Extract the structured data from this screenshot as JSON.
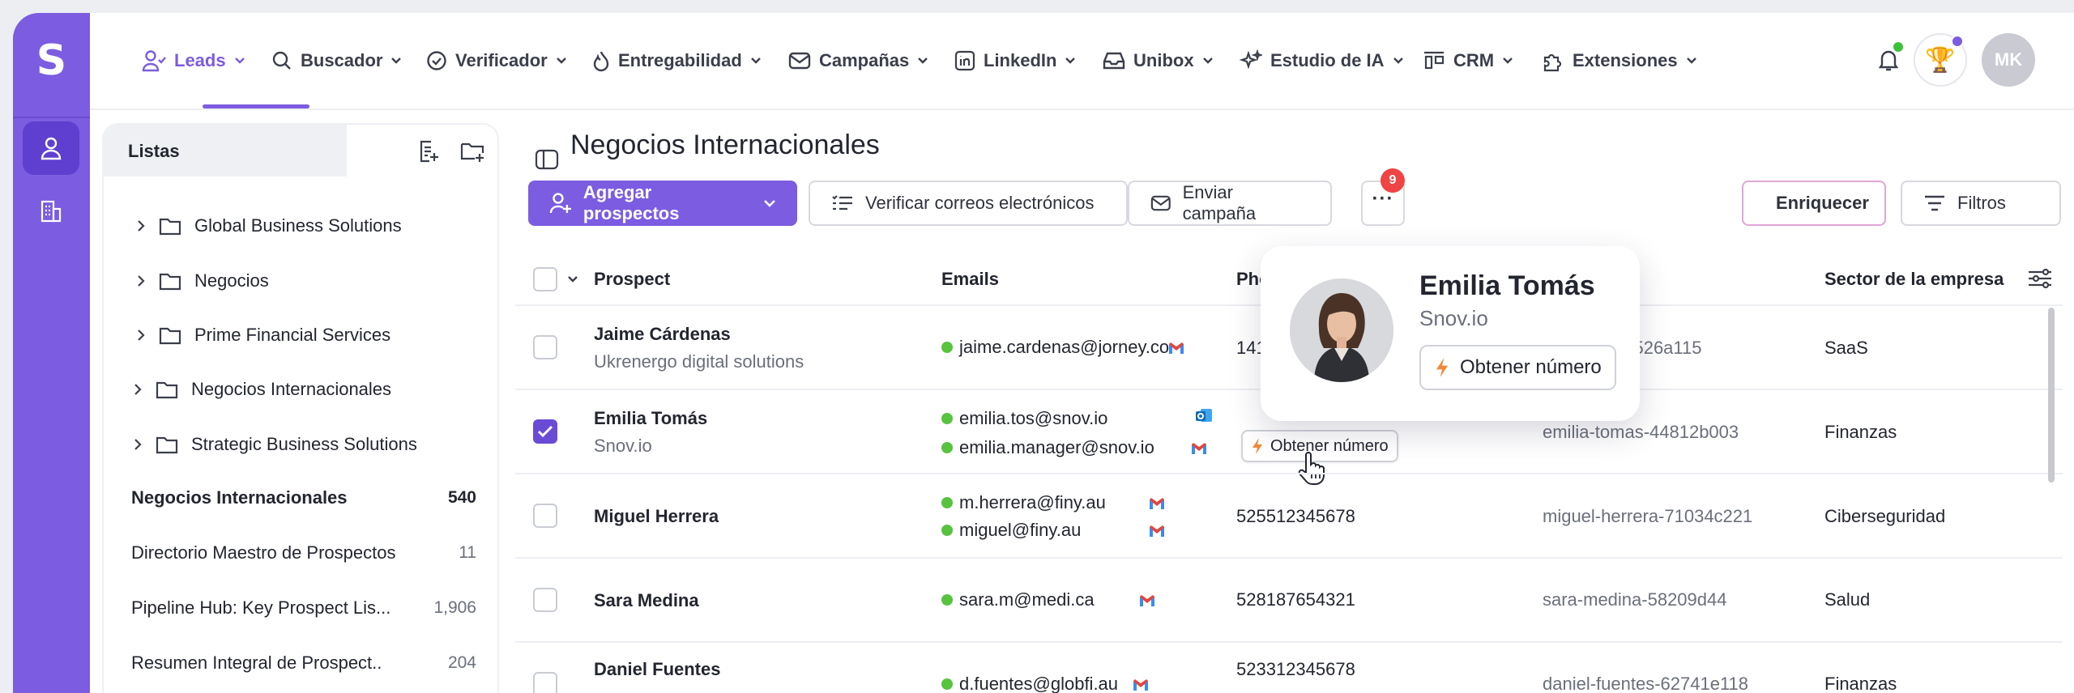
{
  "app": {
    "logo_letter": "S",
    "accent": "#7c5ce0"
  },
  "nav": {
    "items": [
      {
        "label": "Leads",
        "icon": "users-icon",
        "active": true
      },
      {
        "label": "Buscador",
        "icon": "search-icon"
      },
      {
        "label": "Verificador",
        "icon": "check-circle-icon"
      },
      {
        "label": "Entregabilidad",
        "icon": "flame-icon"
      },
      {
        "label": "Campañas",
        "icon": "mail-icon"
      },
      {
        "label": "LinkedIn",
        "icon": "linkedin-icon"
      },
      {
        "label": "Unibox",
        "icon": "inbox-icon"
      },
      {
        "label": "Estudio de IA",
        "icon": "sparkles-icon"
      },
      {
        "label": "CRM",
        "icon": "crm-icon"
      },
      {
        "label": "Extensiones",
        "icon": "puzzle-icon"
      }
    ],
    "avatar_initials": "MK"
  },
  "sidebar": {
    "title": "Listas",
    "folders": [
      "Global Business Solutions",
      "Negocios",
      "Prime Financial Services",
      "Negocios Internacionales",
      "Strategic Business Solutions"
    ],
    "lists": [
      {
        "name": "Negocios Internacionales",
        "count": "540",
        "selected": true
      },
      {
        "name": "Directorio Maestro de Prospectos",
        "count": "11"
      },
      {
        "name": "Pipeline Hub: Key Prospect Lis...",
        "count": "1,906"
      },
      {
        "name": "Resumen Integral de Prospect..",
        "count": "204"
      }
    ]
  },
  "main": {
    "title": "Negocios Internacionales",
    "toolbar": {
      "add": "Agregar prospectos",
      "verify": "Verificar correos electrónicos",
      "campaign": "Enviar campaña",
      "more_badge": "9",
      "enrich": "Enriquecer",
      "filters": "Filtros"
    },
    "columns": {
      "prospect": "Prospect",
      "emails": "Emails",
      "phone": "Pho",
      "company_sector": "Sector de la empresa"
    },
    "rows": [
      {
        "name": "Jaime Cárdenas",
        "company": "Ukrenergo digital solutions",
        "emails": [
          "jaime.cardenas@jorney.co"
        ],
        "phone": "141",
        "linkedin": "29526a115",
        "sector": "SaaS",
        "checked": false
      },
      {
        "name": "Emilia Tomás",
        "company": "Snov.io",
        "emails": [
          "emilia.tos@snov.io",
          "emilia.manager@snov.io"
        ],
        "phone_button": "Obtener número",
        "linkedin": "emilia-tomas-44812b003",
        "sector": "Finanzas",
        "checked": true
      },
      {
        "name": "Miguel Herrera",
        "company": "",
        "emails": [
          "m.herrera@finy.au",
          "miguel@finy.au"
        ],
        "phone": "525512345678",
        "linkedin": "miguel-herrera-71034c221",
        "sector": "Ciberseguridad",
        "checked": false
      },
      {
        "name": "Sara Medina",
        "company": "",
        "emails": [
          "sara.m@medi.ca"
        ],
        "phone": "528187654321",
        "linkedin": "sara-medina-58209d44",
        "sector": "Salud",
        "checked": false
      },
      {
        "name": "Daniel Fuentes",
        "company": "",
        "emails": [
          "d.fuentes@globfi.au"
        ],
        "phone": "523312345678",
        "linkedin": "daniel-fuentes-62741e118",
        "sector": "Finanzas",
        "checked": false
      }
    ]
  },
  "popover": {
    "name": "Emilia Tomás",
    "company": "Snov.io",
    "button": "Obtener número"
  }
}
